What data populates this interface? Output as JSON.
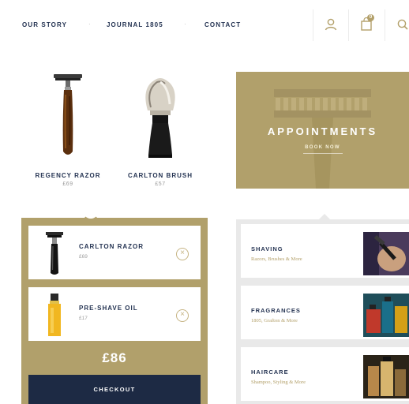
{
  "nav": {
    "links": [
      "OUR STORY",
      "JOURNAL 1805",
      "CONTACT"
    ],
    "separator": "·",
    "icons": [
      "account-icon",
      "cart-icon",
      "search-icon"
    ],
    "cart_count": "0"
  },
  "products": [
    {
      "name": "REGENCY RAZOR",
      "price": "£69"
    },
    {
      "name": "CARLTON BRUSH",
      "price": "£57"
    }
  ],
  "appointments": {
    "title": "APPOINTMENTS",
    "subtitle": "BOOK NOW"
  },
  "basket": {
    "items": [
      {
        "name": "CARLTON RAZOR",
        "price": "£69"
      },
      {
        "name": "PRE-SHAVE OIL",
        "price": "£17"
      }
    ],
    "total": "£86",
    "checkout_label": "CHECKOUT",
    "remove_symbol": "×"
  },
  "categories": [
    {
      "name": "SHAVING",
      "subtitle": "Razors, Brushes & More"
    },
    {
      "name": "FRAGRANCES",
      "subtitle": "1805, Grafton & More"
    },
    {
      "name": "HAIRCARE",
      "subtitle": "Shampoo, Styling & More"
    }
  ],
  "colors": {
    "gold": "#b1a06b",
    "navy": "#1d2a44",
    "light_gray": "#e9e9e9"
  }
}
